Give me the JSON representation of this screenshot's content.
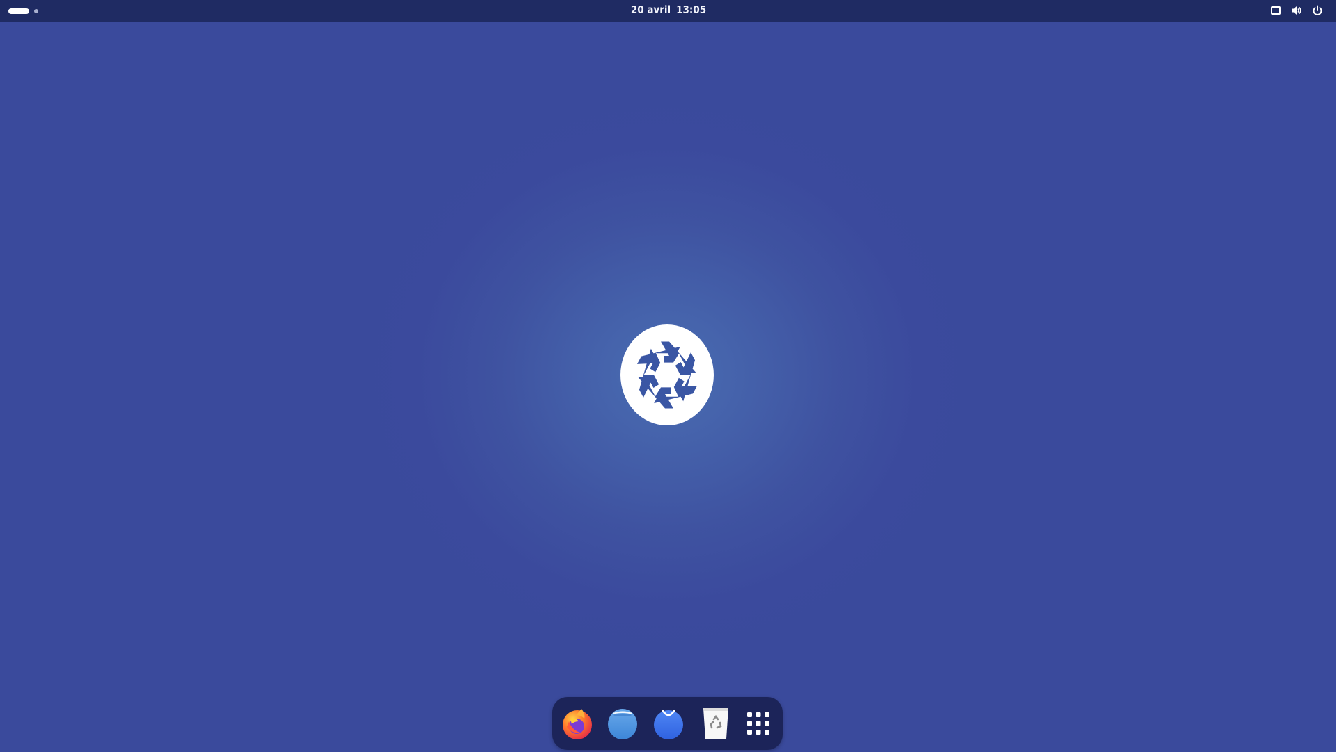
{
  "topbar": {
    "activities_label": "",
    "date": "20 avril",
    "time": "13:05",
    "tray": [
      {
        "icon": "screen-icon"
      },
      {
        "icon": "volume-icon"
      },
      {
        "icon": "power-icon"
      }
    ]
  },
  "desktop": {
    "logo_icon": "nixos-snowflake-icon"
  },
  "dock": {
    "items": [
      {
        "icon": "firefox-icon"
      },
      {
        "icon": "files-icon"
      },
      {
        "icon": "software-store-icon"
      },
      {
        "icon": "trash-icon"
      },
      {
        "icon": "app-grid-icon"
      }
    ]
  },
  "colors": {
    "background": "#3a4a9c",
    "background_glow": "#4a6db2",
    "topbar": "#1f2b63",
    "dock": "#1c2459",
    "logo_white": "#ffffff",
    "logo_blue": "#3a56a4"
  }
}
